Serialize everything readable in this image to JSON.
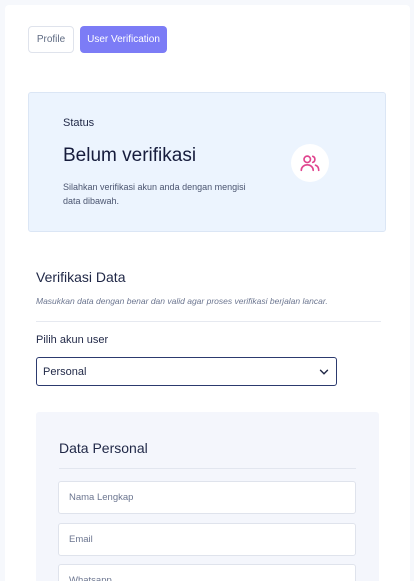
{
  "tabs": [
    {
      "label": "Profile",
      "active": false
    },
    {
      "label": "User Verification",
      "active": true
    }
  ],
  "status": {
    "label": "Status",
    "title": "Belum verifikasi",
    "description": "Silahkan verifikasi akun anda dengan mengisi data dibawah.",
    "icon": "users-icon",
    "icon_color": "#e0458f"
  },
  "verification": {
    "title": "Verifikasi Data",
    "subtitle": "Masukkan data dengan benar dan valid agar proses verifikasi berjalan lancar.",
    "select_label": "Pilih akun user",
    "select_value": "Personal"
  },
  "personal": {
    "title": "Data Personal",
    "fields": [
      {
        "placeholder": "Nama Lengkap"
      },
      {
        "placeholder": "Email"
      },
      {
        "placeholder": "Whatsapp"
      }
    ]
  },
  "colors": {
    "accent": "#7c7cf6",
    "status_bg": "#ecf4fe"
  }
}
